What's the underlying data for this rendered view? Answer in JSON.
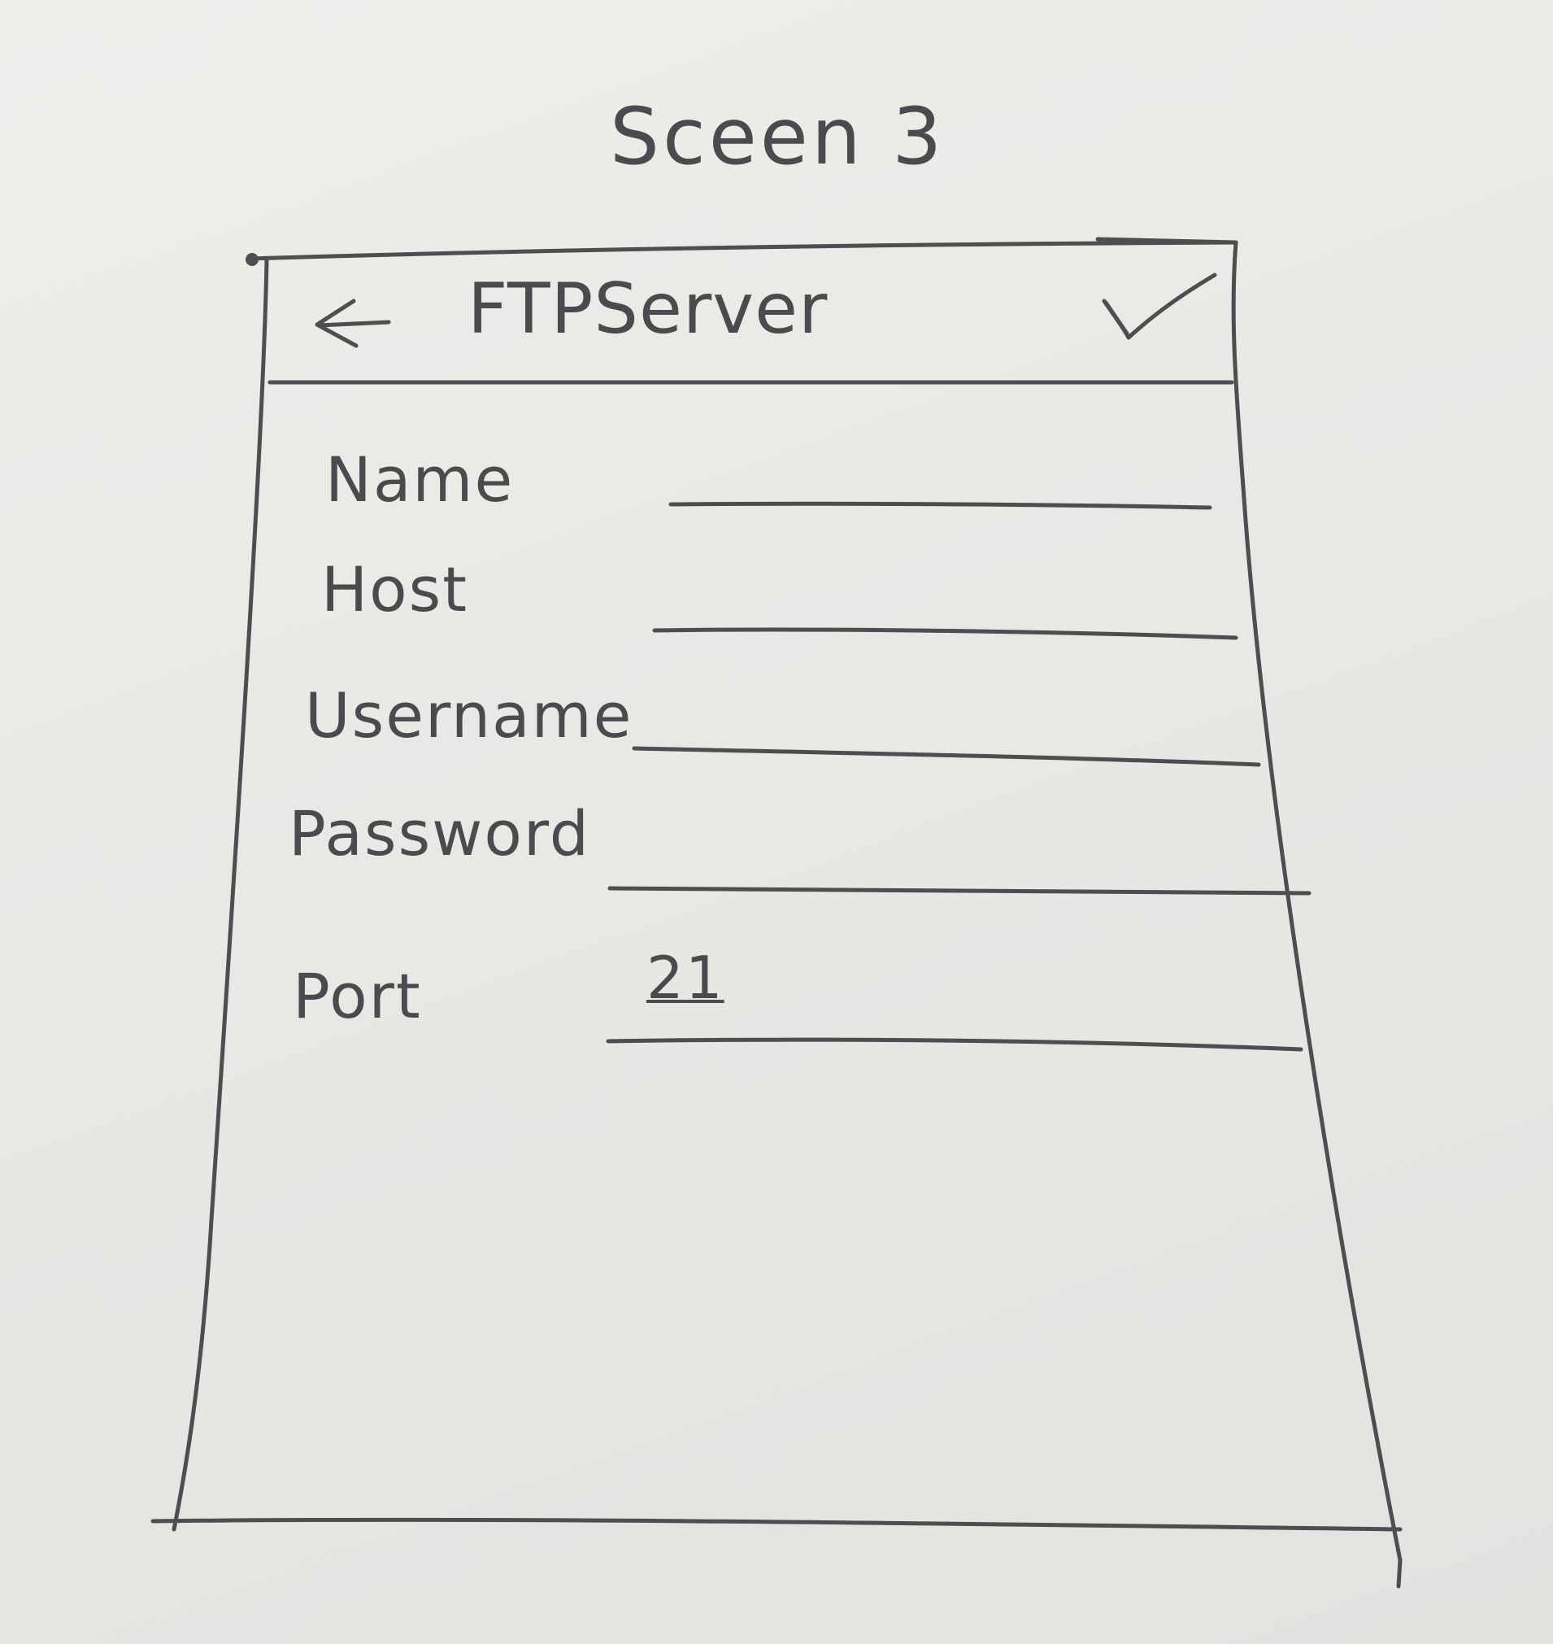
{
  "screen_label": "Sceen 3",
  "app_bar": {
    "back_icon": "left-arrow-icon",
    "title": "FTPServer",
    "confirm_icon": "checkmark-icon"
  },
  "form": {
    "fields": [
      {
        "label": "Name",
        "value": ""
      },
      {
        "label": "Host",
        "value": ""
      },
      {
        "label": "Username",
        "value": ""
      },
      {
        "label": "Password",
        "value": ""
      },
      {
        "label": "Port",
        "value": "21"
      }
    ]
  }
}
